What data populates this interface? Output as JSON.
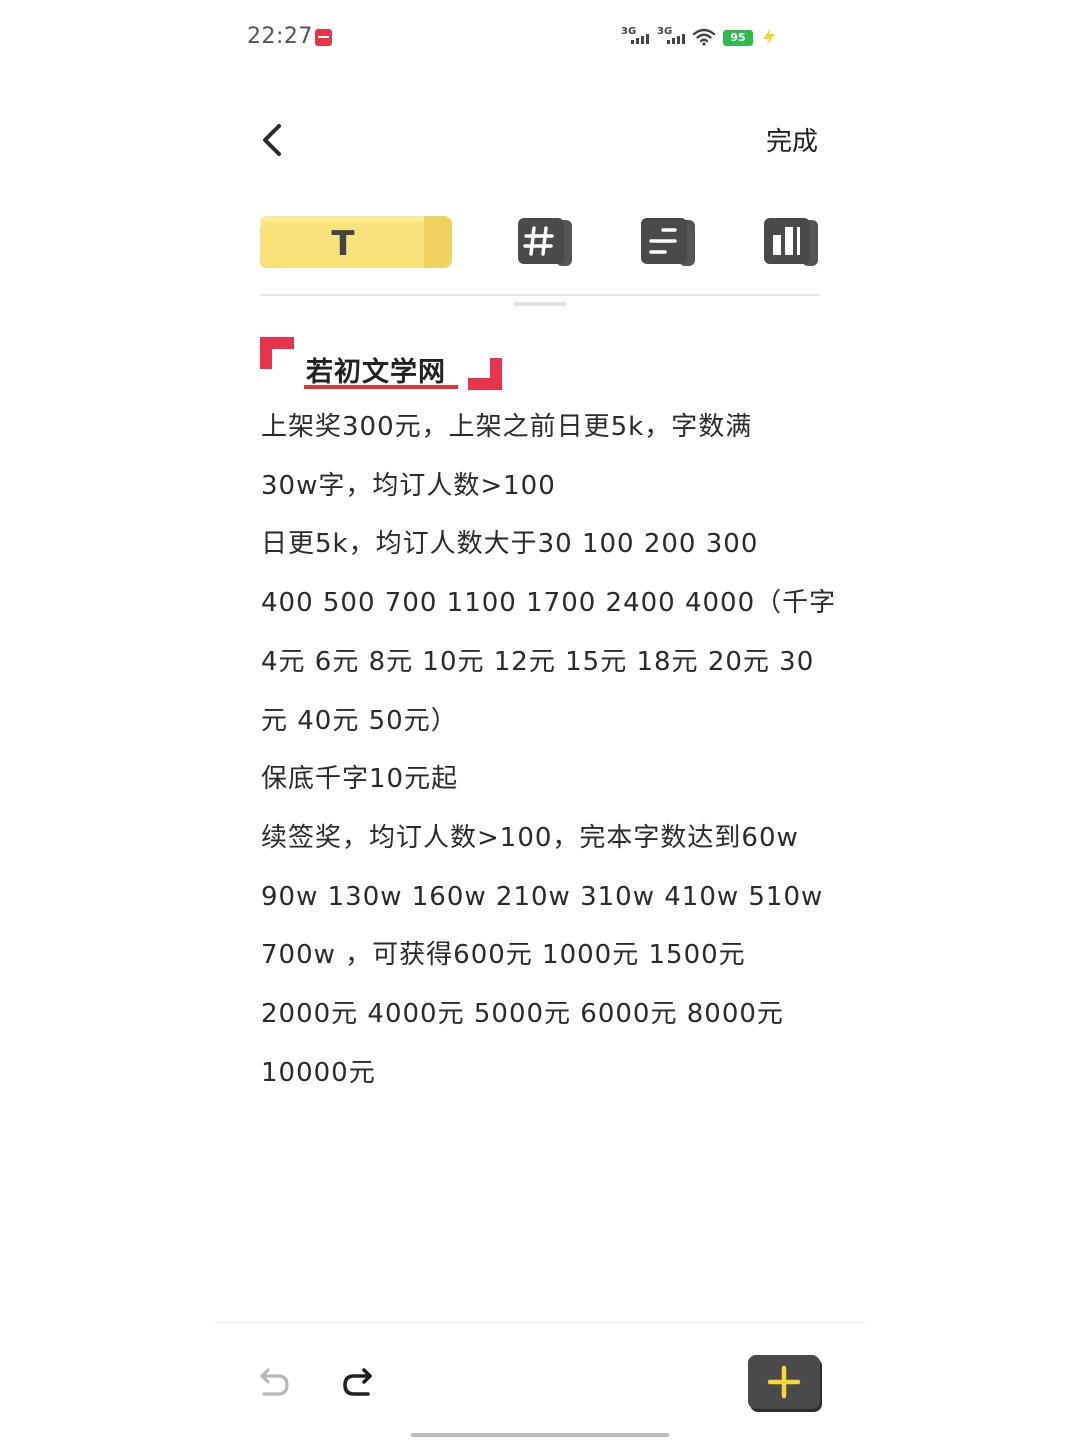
{
  "status_bar": {
    "time": "22:27",
    "network_1": "3G",
    "network_2": "3G",
    "battery_level": "95",
    "notification_icon": "red-app-icon",
    "wifi_icon": "wifi-icon",
    "charging_icon": "lightning-icon"
  },
  "header": {
    "back_icon": "chevron-left-icon",
    "done_label": "完成"
  },
  "toolbar": {
    "text_tab_label": "T",
    "hashtag_icon": "hashtag-icon",
    "list_icon": "list-icon",
    "layout_icon": "layout-icon",
    "active_color": "#f8e27c"
  },
  "note": {
    "heading": "若初文学网",
    "heading_accent_color": "#e8344a",
    "lines": [
      "上架奖300元，上架之前日更5k，字数满",
      "30w字，均订人数>100",
      "日更5k，均订人数大于30 100 200 300",
      "400 500 700 1100 1700 2400 4000（千字",
      "4元 6元 8元 10元 12元 15元 18元 20元 30",
      "元 40元 50元）",
      "保底千字10元起",
      "续签奖，均订人数>100，完本字数达到60w",
      "90w 130w 160w 210w 310w 410w 510w",
      "700w ，可获得600元 1000元 1500元",
      "2000元 4000元 5000元 6000元 8000元",
      "10000元"
    ]
  },
  "bottom_bar": {
    "undo_icon": "undo-icon",
    "redo_icon": "redo-icon",
    "add_icon": "plus-icon",
    "add_icon_color": "#f5d63d"
  }
}
